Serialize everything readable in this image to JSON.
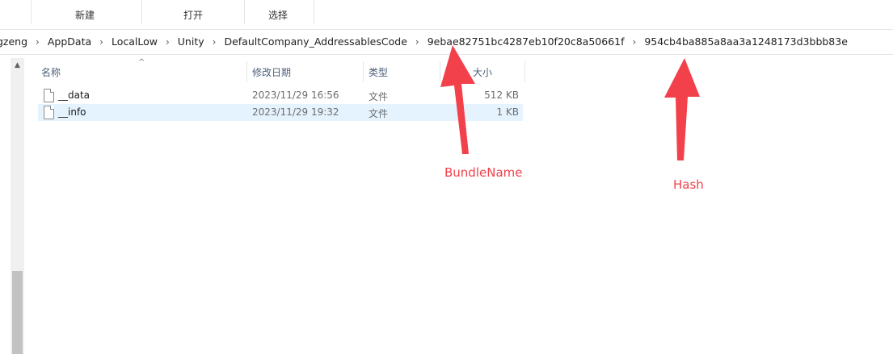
{
  "ribbon": {
    "groups": [
      "新建",
      "打开",
      "选择"
    ]
  },
  "address": {
    "crumbs": [
      "gzeng",
      "AppData",
      "LocalLow",
      "Unity",
      "DefaultCompany_AddressablesCode",
      "9ebae82751bc4287eb10f20c8a50661f",
      "954cb4ba885a8aa3a1248173d3bbb83e"
    ],
    "separator": "›"
  },
  "columns": {
    "name": "名称",
    "date": "修改日期",
    "type": "类型",
    "size": "大小"
  },
  "files": [
    {
      "name": "__data",
      "date": "2023/11/29 16:56",
      "type": "文件",
      "size": "512 KB",
      "selected": false
    },
    {
      "name": "__info",
      "date": "2023/11/29 19:32",
      "type": "文件",
      "size": "1 KB",
      "selected": true
    }
  ],
  "annotations": {
    "bundle_label": "BundleName",
    "hash_label": "Hash",
    "color": "#f2414a"
  },
  "icons": {
    "file": "file-icon",
    "sort": "chevron-up-icon",
    "scroll_up": "scroll-up-arrow-icon"
  }
}
